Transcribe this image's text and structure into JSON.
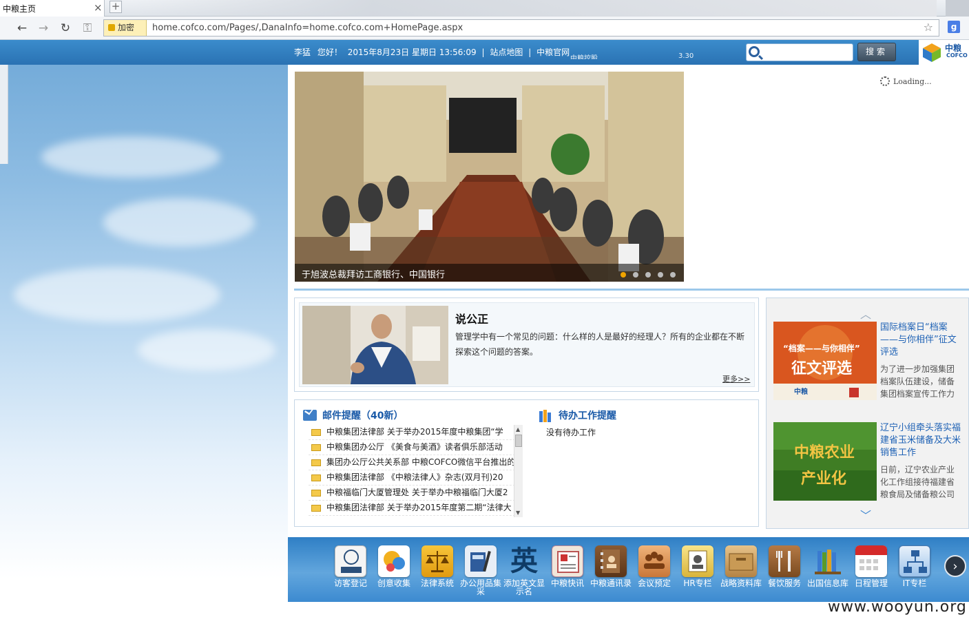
{
  "browser": {
    "tab_title": "中粮主页",
    "tab_close": "×",
    "new_tab": "+",
    "security_label": "加密",
    "url": "home.cofco.com/Pages/,DanaInfo=home.cofco.com+HomePage.aspx",
    "star": "☆",
    "search_engine": "g"
  },
  "header": {
    "user": "李猛",
    "hello": "您好！",
    "datetime": "2015年8月23日 星期日 13:56:09",
    "sep1": "|",
    "sitemap": "站点地图",
    "sep2": "|",
    "official": "中粮官网",
    "ticker1": "中粮控股",
    "ticker2": "3.30",
    "search_placeholder": "",
    "search_btn": "搜索",
    "logo_cn": "中粮",
    "logo_en": "COFCO"
  },
  "slideshow": {
    "caption": "于旭波总裁拜访工商银行、中国银行",
    "dots": 5,
    "active_dot": 0,
    "loading": "Loading..."
  },
  "column": {
    "title": "说公正",
    "text": "管理学中有一个常见的问题：什么样的人是最好的经理人？所有的企业都在不断探索这个问题的答案。",
    "more": "更多>>"
  },
  "mail": {
    "title": "邮件提醒（40新）",
    "items": [
      "中粮集团法律部  关于举办2015年度中粮集团“学",
      "中粮集团办公厅  《美食与美酒》读者俱乐部活动",
      "集团办公厅公共关系部   中粮COFCO微信平台推出的",
      "中粮集团法律部  《中粮法律人》杂志(双月刊)20",
      "中粮福临门大厦管理处  关于举办中粮福临门大厦2",
      "中粮集团法律部  关于举办2015年度第二期“法律大"
    ]
  },
  "todo": {
    "title": "待办工作提醒",
    "empty": "没有待办工作"
  },
  "news": [
    {
      "title": "国际档案日“档案——与你相伴”征文评选",
      "desc": "为了进一步加强集团档案队伍建设，储备集团档案宣传工作力",
      "img_text1": "“档案——与你相伴”",
      "img_text2": "征文评选",
      "img_brand": "中粮"
    },
    {
      "title": "辽宁小组牵头落实福建省玉米储备及大米销售工作",
      "desc": "日前，辽宁农业产业化工作组接待福建省粮食局及储备粮公司",
      "img_text1": "中粮农业",
      "img_text2": "产业化"
    }
  ],
  "apps": [
    {
      "label": "访客登记",
      "icon": "visitor-icon"
    },
    {
      "label": "创意收集",
      "icon": "idea-icon"
    },
    {
      "label": "法律系统",
      "icon": "law-scale-icon"
    },
    {
      "label": "办公用品集采",
      "icon": "office-supplies-icon"
    },
    {
      "label": "添加英文显示名",
      "icon": "english-name-icon",
      "glyph": "英"
    },
    {
      "label": "中粮快讯",
      "icon": "news-flash-icon"
    },
    {
      "label": "中粮通讯录",
      "icon": "address-book-icon"
    },
    {
      "label": "会议预定",
      "icon": "meeting-icon"
    },
    {
      "label": "HR专栏",
      "icon": "hr-icon"
    },
    {
      "label": "战略资料库",
      "icon": "strategy-library-icon"
    },
    {
      "label": "餐饮服务",
      "icon": "dining-icon"
    },
    {
      "label": "出国信息库",
      "icon": "abroad-info-icon"
    },
    {
      "label": "日程管理",
      "icon": "calendar-icon"
    },
    {
      "label": "IT专栏",
      "icon": "it-icon"
    }
  ],
  "watermark": "www.wooyun.org",
  "colors": {
    "header_blue": "#2a72b3",
    "link_blue": "#1f62b5",
    "active_dot": "#f0a400"
  }
}
